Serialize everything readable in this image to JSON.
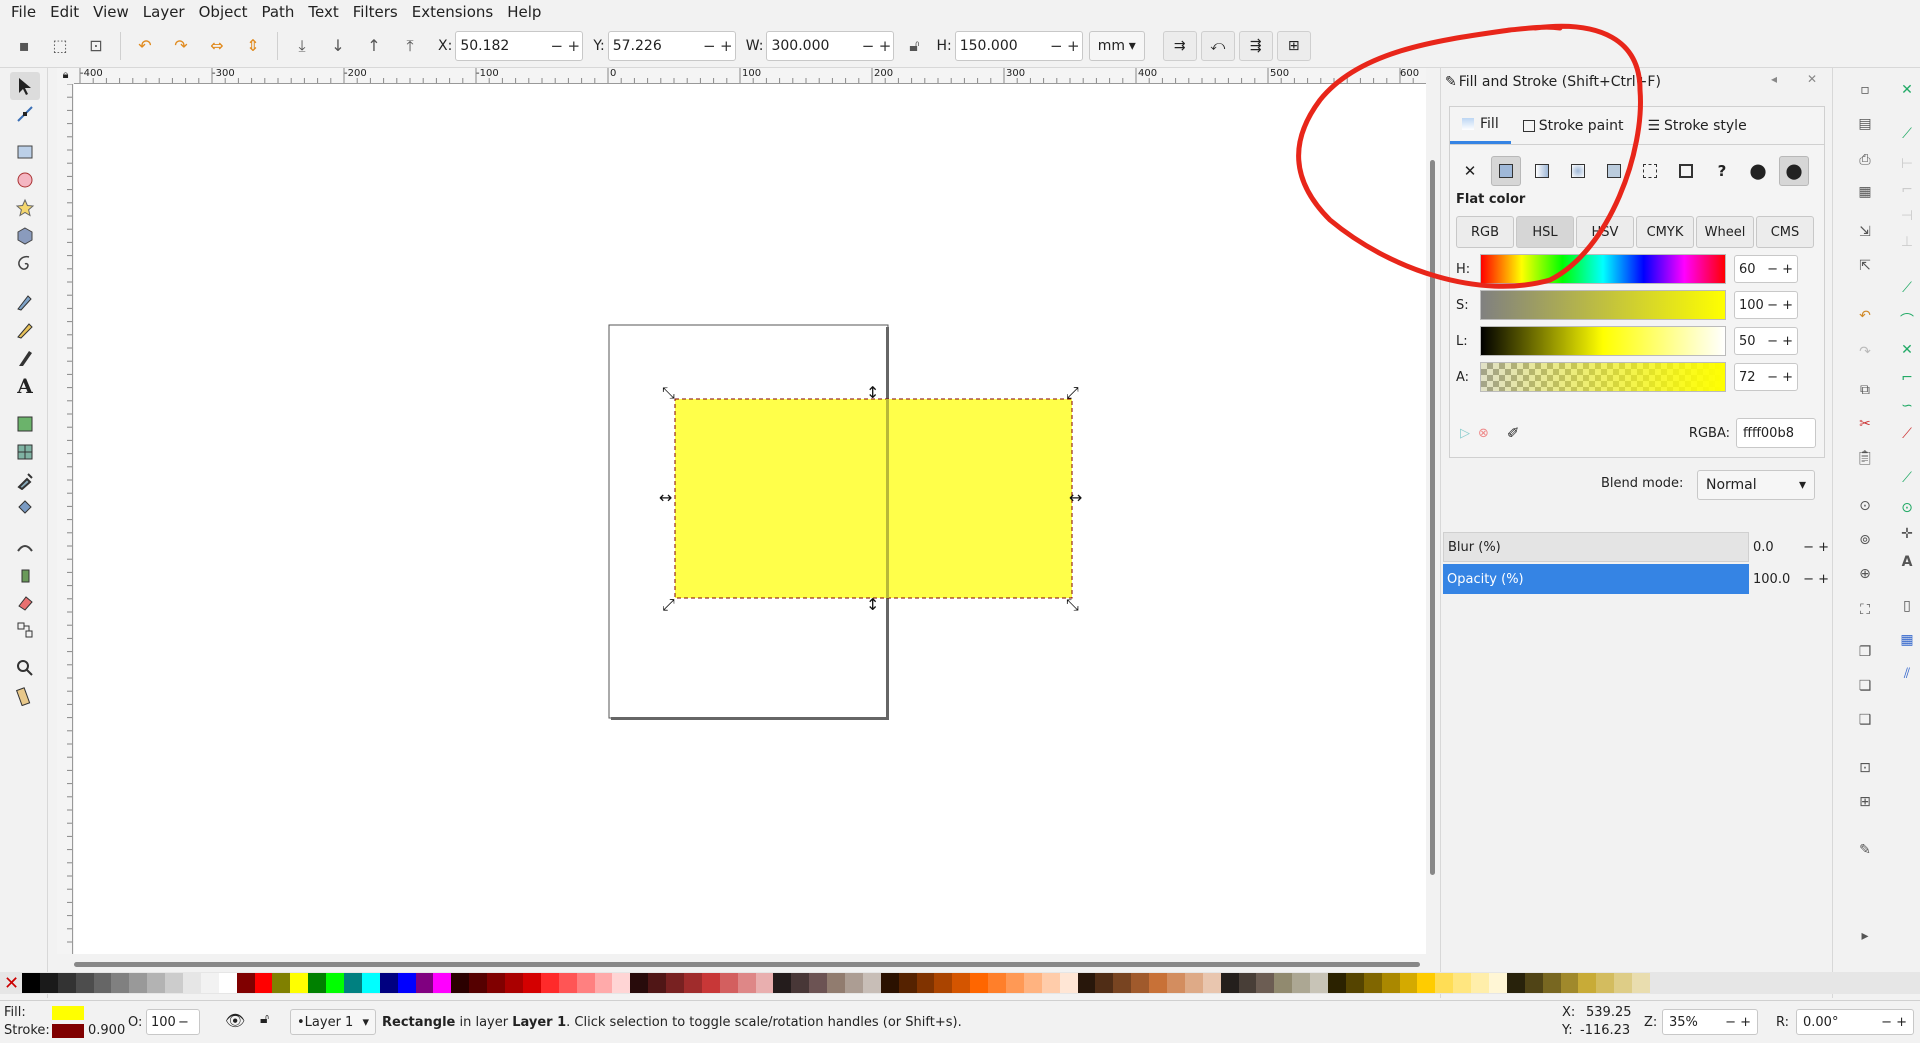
{
  "menu": [
    "File",
    "Edit",
    "View",
    "Layer",
    "Object",
    "Path",
    "Text",
    "Filters",
    "Extensions",
    "Help"
  ],
  "toolbar": {
    "x_label": "X:",
    "x_value": "50.182",
    "y_label": "Y:",
    "y_value": "57.226",
    "w_label": "W:",
    "w_value": "300.000",
    "h_label": "H:",
    "h_value": "150.000",
    "unit": "mm"
  },
  "ruler_h_labels": [
    "-400",
    "-300",
    "-200",
    "-100",
    "0",
    "100",
    "200",
    "300",
    "400",
    "500",
    "600"
  ],
  "dialog": {
    "title": "Fill and Stroke (Shift+Ctrl+F)",
    "tabs": [
      "Fill",
      "Stroke paint",
      "Stroke style"
    ],
    "flat_color_label": "Flat color",
    "modes": [
      "RGB",
      "HSL",
      "HSV",
      "CMYK",
      "Wheel",
      "CMS"
    ],
    "sliders": [
      {
        "label": "H:",
        "value": "60"
      },
      {
        "label": "S:",
        "value": "100"
      },
      {
        "label": "L:",
        "value": "50"
      },
      {
        "label": "A:",
        "value": "72"
      }
    ],
    "rgba_label": "RGBA:",
    "rgba_value": "ffff00b8",
    "blend_label": "Blend mode:",
    "blend_value": "Normal",
    "blur_label": "Blur (%)",
    "blur_value": "0.0",
    "opacity_label": "Opacity (%)",
    "opacity_value": "100.0"
  },
  "status": {
    "fill_label": "Fill:",
    "stroke_label": "Stroke:",
    "stroke_width": "0.900",
    "opacity_label": "O:",
    "opacity_value": "100",
    "layer": "•Layer 1",
    "message_bold": "Rectangle",
    "message": " in layer ",
    "message_layer": "Layer 1",
    "message_tail": ". Click selection to toggle scale/rotation handles (or Shift+s).",
    "cursor_x_label": "X:",
    "cursor_x": "539.25",
    "cursor_y_label": "Y:",
    "cursor_y": "-116.23",
    "zoom_label": "Z:",
    "zoom": "35%",
    "rotation_label": "R:",
    "rotation": "0.00°"
  },
  "colors": {
    "fill": "#ffff00",
    "fill_rect": "#ffff40",
    "stroke": "#800000",
    "accent": "#3584e4",
    "annotation": "#e8261a"
  }
}
